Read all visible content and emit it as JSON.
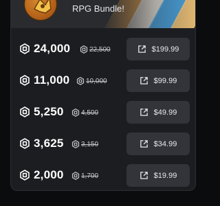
{
  "bundle": {
    "title": "RPG Bundle!",
    "icon": "bundle-character-icon"
  },
  "currency_icon": "robux-icon",
  "button_icon": "external-link-icon",
  "colors": {
    "background": "#0b0c0e",
    "card": "#1c1d21",
    "button": "#323439",
    "text": "#ffffff",
    "muted_text": "#c7c9cd"
  },
  "offers": [
    {
      "amount": "24,000",
      "original": "22,500",
      "price": "$199.99"
    },
    {
      "amount": "11,000",
      "original": "10,000",
      "price": "$99.99"
    },
    {
      "amount": "5,250",
      "original": "4,500",
      "price": "$49.99"
    },
    {
      "amount": "3,625",
      "original": "3,150",
      "price": "$34.99"
    },
    {
      "amount": "2,000",
      "original": "1,700",
      "price": "$19.99"
    }
  ]
}
